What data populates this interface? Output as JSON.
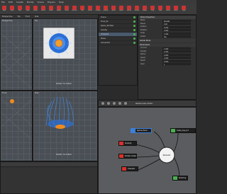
{
  "menu": {
    "items": [
      "File",
      "Edit",
      "Create",
      "Modify",
      "Scene",
      "Physics",
      "Help"
    ]
  },
  "toolbar": {
    "buttons": [
      "New",
      "Open",
      "Save",
      "Undo",
      "Redo",
      "Select",
      "Move",
      "Rotate",
      "Scale",
      "Emitter",
      "Fluid",
      "Solver",
      "Collider",
      "Gravity",
      "Wind",
      "Noise",
      "Vortex",
      "Render",
      "Export",
      "Play",
      "Stop",
      "Cache",
      "Mesh",
      "Light"
    ]
  },
  "viewports": {
    "tabs": [
      "Perspective",
      "Top",
      "Front",
      "Side"
    ],
    "labels": [
      "Perspective",
      "Top",
      "Front",
      "Side"
    ],
    "overlay_top": "FRONT TO X5500",
    "overlay_bottom": "FRONT TO X5500"
  },
  "scene": {
    "items": [
      {
        "label": "Scene",
        "selected": false
      },
      {
        "label": "Fluid_01",
        "selected": false
      },
      {
        "label": "Spline_Emitter",
        "selected": false
      },
      {
        "label": "Gravity",
        "selected": false
      },
      {
        "label": "Vortex01",
        "selected": true
      },
      {
        "label": "Noise",
        "selected": false
      },
      {
        "label": "Camera01",
        "selected": false
      }
    ]
  },
  "properties": {
    "title": "Node Properties",
    "node_label": "Node01",
    "rows": [
      {
        "label": "Name",
        "value": "Node01"
      },
      {
        "label": "Parent",
        "value": "0.00"
      },
      {
        "label": "Position",
        "value": "0.000"
      },
      {
        "label": "Rotation",
        "value": "0.000"
      },
      {
        "label": "Scale",
        "value": "1.000"
      },
      {
        "label": "Visible",
        "value": "Yes"
      }
    ],
    "section1": "Global Node",
    "section2": "Parameters",
    "rows2": [
      {
        "label": "Amount",
        "value": "1.000"
      },
      {
        "label": "Density",
        "value": "0.300"
      },
      {
        "label": "Radius",
        "value": "0.050"
      },
      {
        "label": "Speed",
        "value": "2.000"
      },
      {
        "label": "Falloff",
        "value": "0.500"
      },
      {
        "label": "Seed",
        "value": "1"
      }
    ]
  },
  "node_editor": {
    "title": "Relationship Editor",
    "nodes": {
      "spline_fluid": "Spline fluid",
      "cube_top": "Cube_top_01",
      "gravity": "Gravity",
      "vortex": "Vortex",
      "vortex_index": "Vortex index",
      "node01": "Node01",
      "dummy": "Dummy",
      "cube": "Cube01"
    }
  },
  "colors": {
    "node_center": "#f2f2f2",
    "port_red": "#d9312b",
    "port_green": "#4caf50",
    "port_blue": "#3d7fd9",
    "highlight_orange": "#f28a1e"
  }
}
